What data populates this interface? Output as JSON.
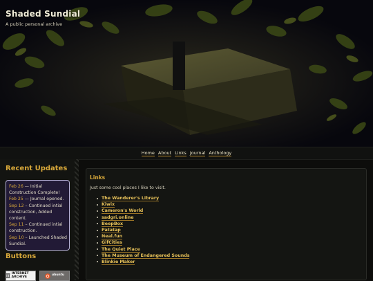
{
  "site": {
    "title": "Shaded Sundial",
    "tagline": "A public personal archive"
  },
  "nav": [
    "Home",
    "About",
    "Links",
    "Journal",
    "Anthology"
  ],
  "sidebar": {
    "updates_title": "Recent Updates",
    "updates": [
      {
        "date": "Feb 26",
        "text": " — Initial Construction Complete!"
      },
      {
        "date": "Feb 25",
        "text": " — Journal opened."
      },
      {
        "date": "Sep 12",
        "text": " – Continued intial construction, Added content."
      },
      {
        "date": "Sep 11",
        "text": " – Continued intial construction."
      },
      {
        "date": "Sep 10",
        "text": " – Launched Shaded Sundial."
      }
    ],
    "buttons_title": "Buttons",
    "badges": [
      "INTERNET ARCHIVE",
      "ubuntu"
    ]
  },
  "main": {
    "heading": "Links",
    "intro": "Just some cool places I like to visit.",
    "links": [
      "The Wanderer's Library",
      "Kiwix",
      "Cameron's World",
      "sadgri.online",
      "BeepBox",
      "Patatap",
      "Neal.fun",
      "GifCities",
      "The Quiet Place",
      "The Museum of Endangered Sounds",
      "Blinkie Maker"
    ]
  },
  "colors": {
    "accent": "#d9a93a",
    "link": "#e8c25a",
    "updates_box_bg": "#221a36",
    "updates_box_border": "#b7b1d8"
  }
}
